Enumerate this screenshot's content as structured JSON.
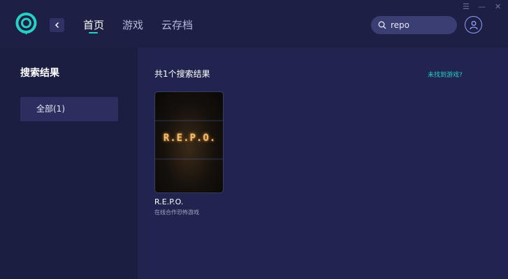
{
  "nav": {
    "tabs": [
      {
        "label": "首页",
        "active": true
      },
      {
        "label": "游戏",
        "active": false
      },
      {
        "label": "云存档",
        "active": false
      }
    ]
  },
  "window_controls": {
    "menu": "☰",
    "minimize": "—",
    "close": "✕"
  },
  "search": {
    "value": "repo"
  },
  "sidebar": {
    "title": "搜索结果",
    "items": [
      {
        "label": "全部(1)",
        "selected": true
      }
    ]
  },
  "main": {
    "result_count": "共1个搜索结果",
    "not_found_link": "未找到游戏?",
    "games": [
      {
        "cover_title": "R.E.P.O.",
        "name": "R.E.P.O.",
        "description": "在线合作恐怖游戏"
      }
    ]
  },
  "colors": {
    "accent": "#27d0c4",
    "background": "#1f2148",
    "topbar": "#1d1f44",
    "sidebar": "#1b1d41"
  }
}
